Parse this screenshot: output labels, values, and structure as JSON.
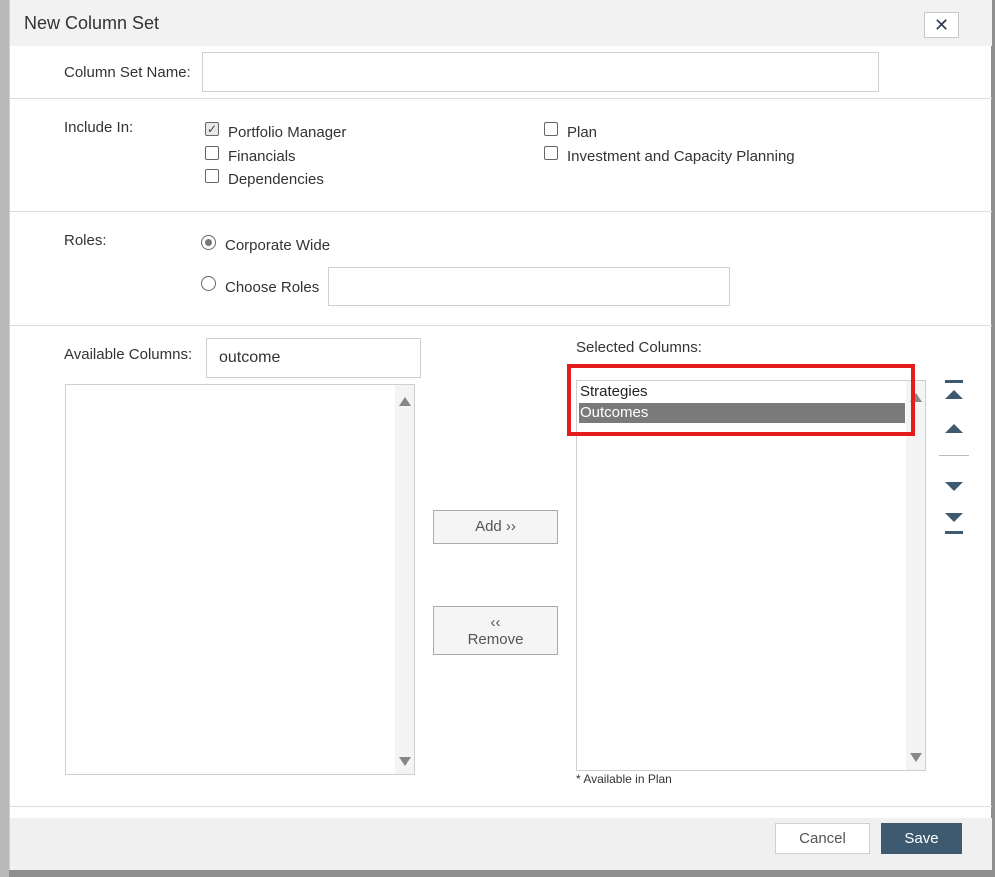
{
  "dialog": {
    "title": "New Column Set",
    "close_icon": "close-icon",
    "close_glyph": "✕"
  },
  "column_set_name": {
    "label": "Column Set Name:",
    "value": "",
    "placeholder": ""
  },
  "include_in": {
    "label": "Include In:",
    "options": [
      {
        "label": "Portfolio Manager",
        "checked": true
      },
      {
        "label": "Financials",
        "checked": false
      },
      {
        "label": "Dependencies",
        "checked": false
      },
      {
        "label": "Plan",
        "checked": false
      },
      {
        "label": "Investment and Capacity Planning",
        "checked": false
      }
    ],
    "check_glyph": "✓"
  },
  "roles": {
    "label": "Roles:",
    "corporate_wide_label": "Corporate Wide",
    "choose_roles_label": "Choose Roles",
    "selected": "Corporate Wide",
    "choose_roles_value": ""
  },
  "available_columns": {
    "label": "Available Columns:",
    "filter_value": "outcome",
    "items": []
  },
  "transfer": {
    "add_label": "Add ››",
    "remove_glyph": "‹‹",
    "remove_label": "Remove"
  },
  "selected_columns": {
    "label": "Selected Columns:",
    "items": [
      {
        "label": "Strategies",
        "selected": false
      },
      {
        "label": "Outcomes",
        "selected": true
      }
    ],
    "footnote": "* Available in Plan"
  },
  "ordering": {
    "icons": [
      "move-to-top-icon",
      "move-up-icon",
      "move-down-icon",
      "move-to-bottom-icon"
    ]
  },
  "footer": {
    "cancel_label": "Cancel",
    "save_label": "Save"
  },
  "colors": {
    "primary_button": "#3d5a70",
    "highlight_border": "#e51c1c",
    "selected_item_bg": "#7a7a7a"
  }
}
